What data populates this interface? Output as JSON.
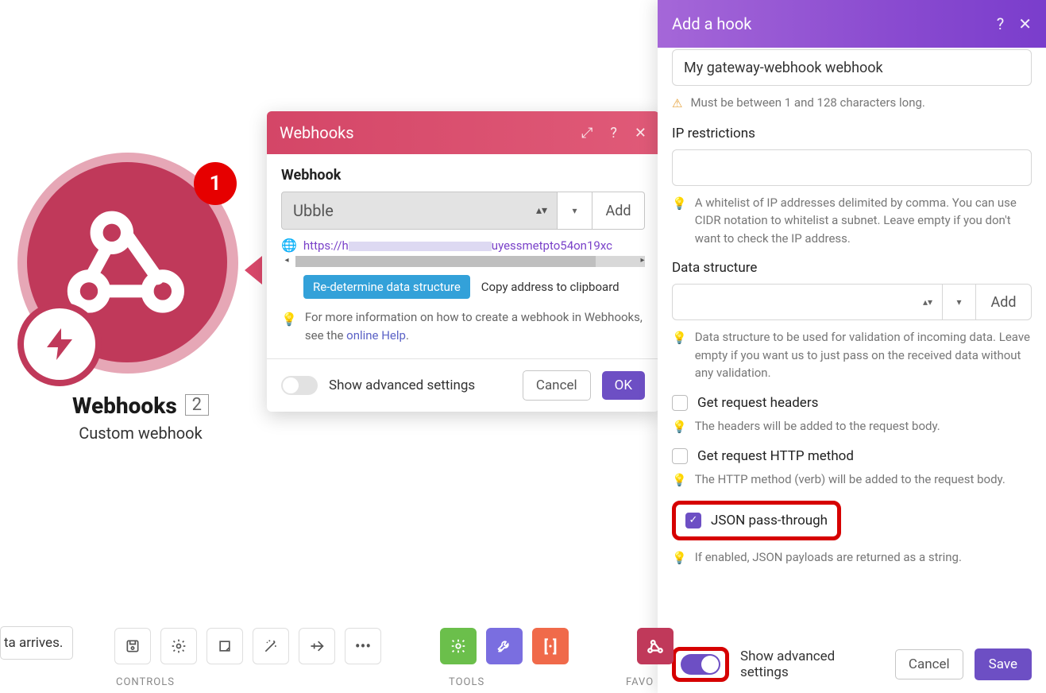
{
  "node": {
    "badge": "1",
    "title": "Webhooks",
    "count": "2",
    "subtitle": "Custom webhook"
  },
  "webhooks_modal": {
    "title": "Webhooks",
    "section_label": "Webhook",
    "select_value": "Ubble",
    "add_btn": "Add",
    "url_prefix": "https://h",
    "url_suffix": "uyessmetpto54on19xc",
    "redetermine_btn": "Re-determine data structure",
    "copy_link": "Copy address to clipboard",
    "hint_text": "For more information on how to create a webhook in Webhooks, see the ",
    "hint_link": "online Help",
    "hint_period": ".",
    "show_advanced": "Show advanced settings",
    "cancel": "Cancel",
    "ok": "OK"
  },
  "hook_panel": {
    "title": "Add a hook",
    "name_value": "My gateway-webhook webhook",
    "name_tip": "Must be between 1 and 128 characters long.",
    "ip_label": "IP restrictions",
    "ip_tip": "A whitelist of IP addresses delimited by comma. You can use CIDR notation to whitelist a subnet. Leave empty if you don't want to check the IP address.",
    "ds_label": "Data structure",
    "ds_add": "Add",
    "ds_tip": "Data structure to be used for validation of incoming data. Leave empty if you want us to just pass on the received data without any validation.",
    "headers_label": "Get request headers",
    "headers_tip": "The headers will be added to the request body.",
    "method_label": "Get request HTTP method",
    "method_tip": "The HTTP method (verb) will be added to the request body.",
    "json_label": "JSON pass-through",
    "json_tip": "If enabled, JSON payloads are returned as a string.",
    "show_advanced": "Show advanced settings",
    "cancel": "Cancel",
    "save": "Save"
  },
  "bottom": {
    "partial": "ta arrives.",
    "controls": "CONTROLS",
    "tools": "TOOLS",
    "favorites": "FAVO"
  }
}
